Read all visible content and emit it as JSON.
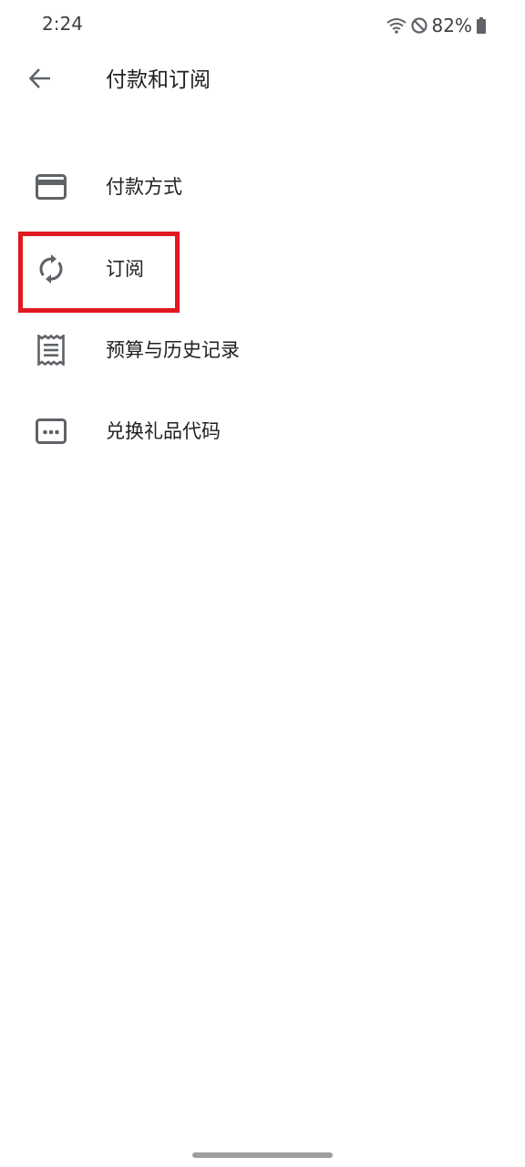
{
  "status_bar": {
    "time": "2:24",
    "battery": "82%",
    "icons": [
      "wifi-icon",
      "do-not-disturb-icon",
      "battery-icon"
    ]
  },
  "app_bar": {
    "back_icon": "arrow-back-icon",
    "title": "付款和订阅"
  },
  "menu": {
    "items": [
      {
        "label": "付款方式",
        "icon": "credit-card-icon"
      },
      {
        "label": "订阅",
        "icon": "autorenew-icon",
        "highlighted": true
      },
      {
        "label": "预算与历史记录",
        "icon": "receipt-icon"
      },
      {
        "label": "兑换礼品代码",
        "icon": "redeem-code-icon"
      }
    ]
  },
  "colors": {
    "icon": "#5f6368",
    "text": "#202124",
    "highlight": "#e0181f"
  }
}
